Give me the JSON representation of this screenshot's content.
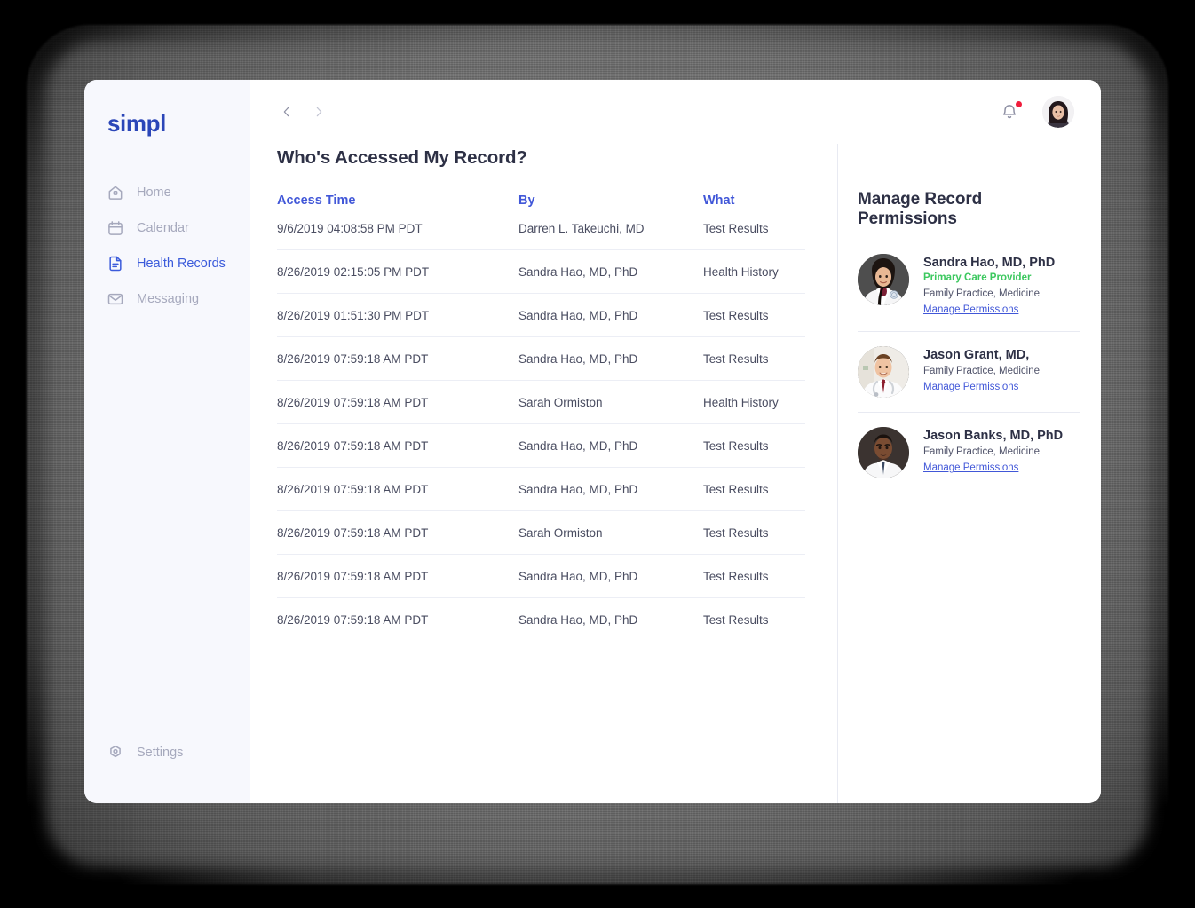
{
  "brand": "simpl",
  "sidebar": {
    "items": [
      {
        "label": "Home",
        "icon": "home-icon",
        "active": false
      },
      {
        "label": "Calendar",
        "icon": "calendar-icon",
        "active": false
      },
      {
        "label": "Health Records",
        "icon": "document-icon",
        "active": true
      },
      {
        "label": "Messaging",
        "icon": "envelope-icon",
        "active": false
      }
    ],
    "settings": {
      "label": "Settings",
      "icon": "gear-icon"
    }
  },
  "topbar": {
    "back_icon": "chevron-left-icon",
    "forward_icon": "chevron-right-icon",
    "bell_icon": "bell-icon",
    "notification_dot": true,
    "avatar": "user-avatar"
  },
  "main": {
    "page_title": "Who's Accessed My Record?",
    "table": {
      "columns": [
        "Access Time",
        "By",
        "What"
      ],
      "rows": [
        [
          "9/6/2019 04:08:58 PM PDT",
          "Darren L. Takeuchi, MD",
          "Test Results"
        ],
        [
          "8/26/2019 02:15:05 PM PDT",
          "Sandra Hao, MD, PhD",
          "Health History"
        ],
        [
          "8/26/2019 01:51:30 PM PDT",
          "Sandra Hao, MD, PhD",
          "Test Results"
        ],
        [
          "8/26/2019 07:59:18 AM PDT",
          "Sandra Hao, MD, PhD",
          "Test Results"
        ],
        [
          "8/26/2019 07:59:18 AM PDT",
          "Sarah Ormiston",
          "Health History"
        ],
        [
          "8/26/2019 07:59:18 AM PDT",
          "Sandra Hao, MD, PhD",
          "Test Results"
        ],
        [
          "8/26/2019 07:59:18 AM PDT",
          "Sandra Hao, MD, PhD",
          "Test Results"
        ],
        [
          "8/26/2019 07:59:18 AM PDT",
          "Sarah Ormiston",
          "Test Results"
        ],
        [
          "8/26/2019 07:59:18 AM PDT",
          "Sandra Hao, MD, PhD",
          "Test Results"
        ],
        [
          "8/26/2019 07:59:18 AM PDT",
          "Sandra Hao, MD, PhD",
          "Test Results"
        ]
      ]
    }
  },
  "right_panel": {
    "title": "Manage Record Permissions",
    "providers": [
      {
        "name": "Sandra Hao, MD, PhD",
        "role": "Primary Care Provider",
        "specialty": "Family Practice, Medicine",
        "link": "Manage Permissions",
        "avatar": "provider-photo-sandra-hao"
      },
      {
        "name": "Jason Grant, MD,",
        "role": "",
        "specialty": "Family Practice, Medicine",
        "link": "Manage Permissions",
        "avatar": "provider-photo-jason-grant"
      },
      {
        "name": "Jason Banks, MD, PhD",
        "role": "",
        "specialty": "Family Practice, Medicine",
        "link": "Manage Permissions",
        "avatar": "provider-photo-jason-banks"
      }
    ]
  },
  "colors": {
    "brand_blue": "#2b46b8",
    "link_blue": "#4157d8",
    "accent_green": "#3cc85f",
    "notification_red": "#f01d3c",
    "sidebar_bg": "#f7f8fd",
    "text_dark": "#2d3045",
    "text_muted": "#a6a9bd"
  }
}
